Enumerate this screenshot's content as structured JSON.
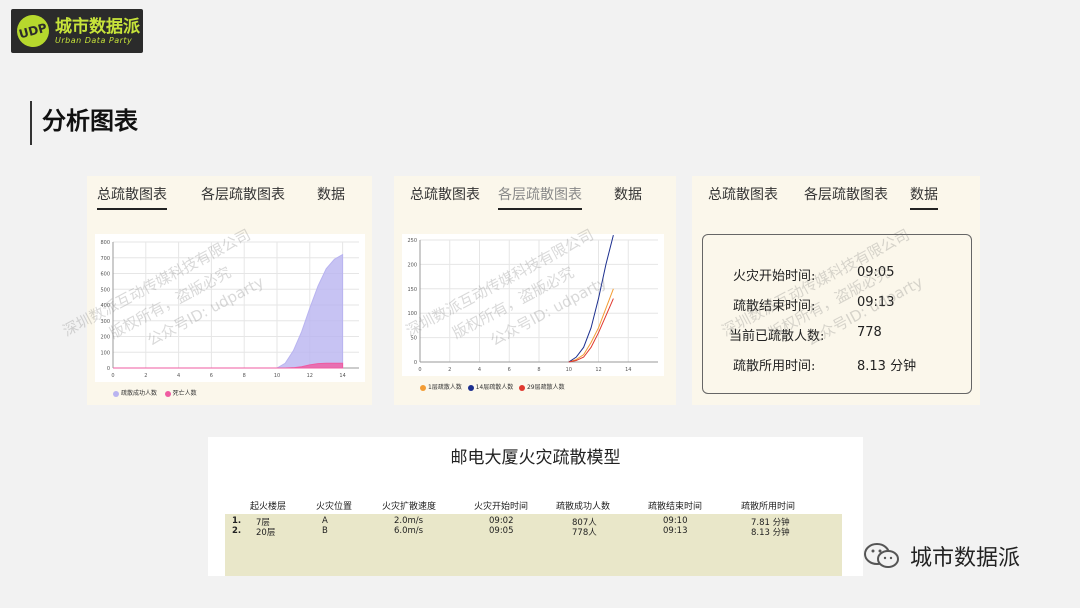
{
  "logo": {
    "cn": "城市数据派",
    "en": "Urban Data Party",
    "mark": "UDP"
  },
  "section_title": "分析图表",
  "panel1": {
    "tabs": [
      "总疏散图表",
      "各层疏散图表",
      "数据"
    ],
    "active_tab": 0,
    "legend": [
      "疏散成功人数",
      "死亡人数"
    ]
  },
  "panel2": {
    "tabs": [
      "总疏散图表",
      "各层疏散图表",
      "数据"
    ],
    "active_tab": 1,
    "legend": [
      "1层疏散人数",
      "14层疏散人数",
      "29层疏散人数"
    ]
  },
  "panel3": {
    "tabs": [
      "总疏散图表",
      "各层疏散图表",
      "数据"
    ],
    "active_tab": 2,
    "rows": [
      {
        "label": "火灾开始时间:",
        "value": "09:05"
      },
      {
        "label": "疏散结束时间:",
        "value": "09:13"
      },
      {
        "label": "当前已疏散人数:",
        "value": "778"
      },
      {
        "label": "疏散所用时间:",
        "value": "8.13 分钟"
      }
    ]
  },
  "watermark": {
    "line1": "深圳数派互动传媒科技有限公司",
    "line2": "版权所有，盗版必究",
    "line3": "公众号ID: udparty"
  },
  "table": {
    "title": "邮电大厦火灾疏散模型",
    "headers": [
      "起火楼层",
      "火灾位置",
      "火灾扩散速度",
      "火灾开始时间",
      "疏散成功人数",
      "疏散结束时间",
      "疏散所用时间"
    ],
    "rows": [
      {
        "idx": "1.",
        "cells": [
          "7层",
          "A",
          "2.0m/s",
          "09:02",
          "807人",
          "09:10",
          "7.81 分钟"
        ]
      },
      {
        "idx": "2.",
        "cells": [
          "20层",
          "B",
          "6.0m/s",
          "09:05",
          "778人",
          "09:13",
          "8.13 分钟"
        ]
      }
    ]
  },
  "footer": {
    "brand": "城市数据派"
  },
  "chart_data": [
    {
      "type": "area",
      "x": [
        0,
        2,
        4,
        6,
        8,
        9,
        10,
        10.5,
        11,
        11.5,
        12,
        12.5,
        13,
        13.5,
        14
      ],
      "series": [
        {
          "name": "疏散成功人数",
          "color": "#b9b4f0",
          "values": [
            0,
            0,
            0,
            0,
            0,
            0,
            0,
            30,
            110,
            230,
            380,
            520,
            630,
            690,
            720
          ]
        },
        {
          "name": "死亡人数",
          "color": "#ef5ba1",
          "values": [
            0,
            0,
            0,
            0,
            0,
            0,
            0,
            0,
            2,
            8,
            20,
            28,
            30,
            30,
            30
          ]
        }
      ],
      "xlim": [
        0,
        15
      ],
      "ylim": [
        0,
        800
      ],
      "xticks": [
        0,
        2,
        4,
        6,
        8,
        10,
        12,
        14
      ],
      "yticks": [
        0,
        100,
        200,
        300,
        400,
        500,
        600,
        700,
        800
      ],
      "grid": true,
      "legend": "bottom"
    },
    {
      "type": "line",
      "x": [
        10,
        10.5,
        11,
        11.5,
        12,
        12.5,
        13
      ],
      "series": [
        {
          "name": "1层疏散人数",
          "color": "#f39c34",
          "values": [
            0,
            5,
            15,
            40,
            70,
            110,
            150
          ]
        },
        {
          "name": "14层疏散人数",
          "color": "#1c2f8f",
          "values": [
            0,
            10,
            30,
            70,
            130,
            200,
            260
          ]
        },
        {
          "name": "29层疏散人数",
          "color": "#e0392f",
          "values": [
            0,
            3,
            10,
            30,
            60,
            95,
            130
          ]
        }
      ],
      "xlim": [
        0,
        16
      ],
      "ylim": [
        0,
        250
      ],
      "xticks": [
        0,
        2,
        4,
        6,
        8,
        10,
        12,
        14
      ],
      "yticks": [
        0,
        50,
        100,
        150,
        200,
        250
      ],
      "grid": true,
      "legend": "bottom"
    }
  ]
}
